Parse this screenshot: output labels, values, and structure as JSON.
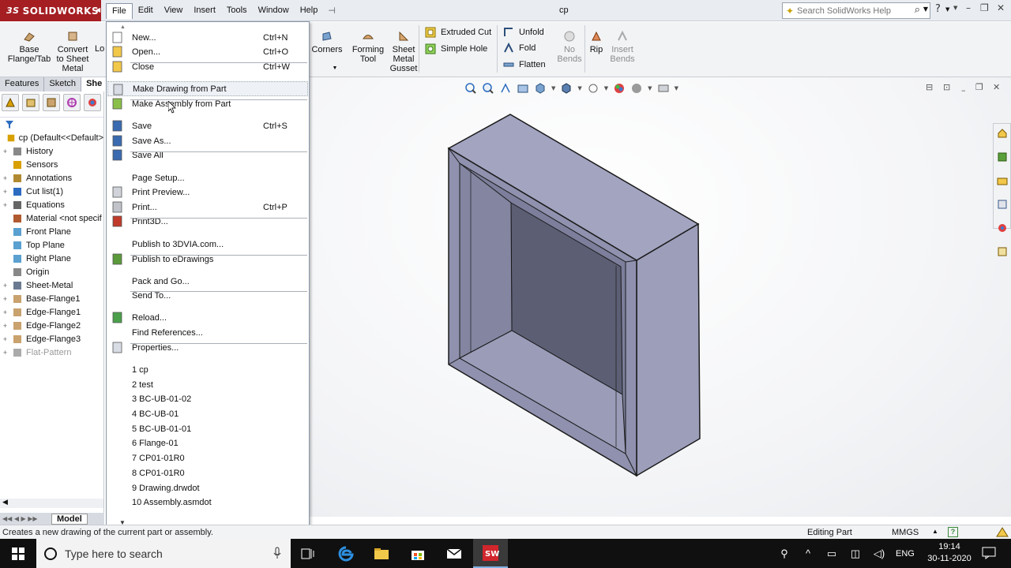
{
  "app": {
    "logo_text": "SOLIDWORKS",
    "logo_prefix": "3S",
    "document_title": "cp"
  },
  "menubar": [
    "File",
    "Edit",
    "View",
    "Insert",
    "Tools",
    "Window",
    "Help"
  ],
  "search": {
    "placeholder": "Search SolidWorks Help"
  },
  "commands": {
    "base_flange": "Base\nFlange/Tab",
    "convert": "Convert\nto Sheet\nMetal",
    "lofted_partial": "Lo",
    "corners": "Corners",
    "forming_tool": "Forming\nTool",
    "sheet_metal_gusset": "Sheet\nMetal\nGusset",
    "extruded_cut": "Extruded Cut",
    "simple_hole": "Simple Hole",
    "unfold": "Unfold",
    "fold": "Fold",
    "flatten": "Flatten",
    "no_bends": "No\nBends",
    "rip": "Rip",
    "insert_bends": "Insert\nBends"
  },
  "tabs": [
    "Features",
    "Sketch",
    "She"
  ],
  "tree": [
    {
      "label": "cp  (Default<<Default>",
      "icon": "part-icon",
      "expander": ""
    },
    {
      "label": "History",
      "icon": "history-icon",
      "expander": "+"
    },
    {
      "label": "Sensors",
      "icon": "sensors-icon",
      "expander": ""
    },
    {
      "label": "Annotations",
      "icon": "annotations-icon",
      "expander": "+"
    },
    {
      "label": "Cut list(1)",
      "icon": "cutlist-icon",
      "expander": "+"
    },
    {
      "label": "Equations",
      "icon": "equations-icon",
      "expander": "+"
    },
    {
      "label": "Material <not specif",
      "icon": "material-icon",
      "expander": ""
    },
    {
      "label": "Front Plane",
      "icon": "plane-icon",
      "expander": ""
    },
    {
      "label": "Top Plane",
      "icon": "plane-icon",
      "expander": ""
    },
    {
      "label": "Right Plane",
      "icon": "plane-icon",
      "expander": ""
    },
    {
      "label": "Origin",
      "icon": "origin-icon",
      "expander": ""
    },
    {
      "label": "Sheet-Metal",
      "icon": "sheetmetal-icon",
      "expander": "+"
    },
    {
      "label": "Base-Flange1",
      "icon": "baseflange-icon",
      "expander": "+"
    },
    {
      "label": "Edge-Flange1",
      "icon": "edgeflange-icon",
      "expander": "+"
    },
    {
      "label": "Edge-Flange2",
      "icon": "edgeflange-icon",
      "expander": "+"
    },
    {
      "label": "Edge-Flange3",
      "icon": "edgeflange-icon",
      "expander": "+"
    },
    {
      "label": "Flat-Pattern",
      "icon": "flatpattern-icon",
      "expander": "+",
      "greyed": true
    }
  ],
  "bottom_tab": "Model",
  "file_menu": [
    {
      "label": "New...",
      "shortcut": "Ctrl+N",
      "icon": "new-icon"
    },
    {
      "label": "Open...",
      "shortcut": "Ctrl+O",
      "icon": "open-icon"
    },
    {
      "label": "Close",
      "shortcut": "Ctrl+W",
      "icon": "close-doc-icon"
    },
    {
      "label": "Make Drawing from Part",
      "shortcut": "",
      "icon": "make-drawing-icon",
      "hover": true
    },
    {
      "label": "Make Assembly from Part",
      "shortcut": "",
      "icon": "make-assembly-icon"
    },
    {
      "label": "Save",
      "shortcut": "Ctrl+S",
      "icon": "save-icon"
    },
    {
      "label": "Save As...",
      "shortcut": "",
      "icon": "save-as-icon"
    },
    {
      "label": "Save All",
      "shortcut": "",
      "icon": "save-all-icon"
    },
    {
      "label": "Page Setup...",
      "shortcut": "",
      "icon": ""
    },
    {
      "label": "Print Preview...",
      "shortcut": "",
      "icon": "print-preview-icon"
    },
    {
      "label": "Print...",
      "shortcut": "Ctrl+P",
      "icon": "print-icon"
    },
    {
      "label": "Print3D...",
      "shortcut": "",
      "icon": "print3d-icon"
    },
    {
      "label": "Publish to 3DVIA.com...",
      "shortcut": "",
      "icon": ""
    },
    {
      "label": "Publish to eDrawings",
      "shortcut": "",
      "icon": "edrawings-icon"
    },
    {
      "label": "Pack and Go...",
      "shortcut": "",
      "icon": ""
    },
    {
      "label": "Send To...",
      "shortcut": "",
      "icon": ""
    },
    {
      "label": "Reload...",
      "shortcut": "",
      "icon": "reload-icon"
    },
    {
      "label": "Find References...",
      "shortcut": "",
      "icon": ""
    },
    {
      "label": "Properties...",
      "shortcut": "",
      "icon": "properties-icon"
    },
    {
      "label": "1 cp",
      "shortcut": "",
      "icon": ""
    },
    {
      "label": "2 test",
      "shortcut": "",
      "icon": ""
    },
    {
      "label": "3 BC-UB-01-02",
      "shortcut": "",
      "icon": ""
    },
    {
      "label": "4 BC-UB-01",
      "shortcut": "",
      "icon": ""
    },
    {
      "label": "5 BC-UB-01-01",
      "shortcut": "",
      "icon": ""
    },
    {
      "label": "6 Flange-01",
      "shortcut": "",
      "icon": ""
    },
    {
      "label": "7 CP01-01R0",
      "shortcut": "",
      "icon": ""
    },
    {
      "label": "8 CP01-01R0",
      "shortcut": "",
      "icon": ""
    },
    {
      "label": "9 Drawing.drwdot",
      "shortcut": "",
      "icon": ""
    },
    {
      "label": "10 Assembly.asmdot",
      "shortcut": "",
      "icon": ""
    }
  ],
  "statusbar": {
    "message": "Creates a new drawing of the current part or assembly.",
    "mode": "Editing Part",
    "units": "MMGS"
  },
  "taskbar": {
    "search_placeholder": "Type here to search",
    "language": "ENG",
    "time": "19:14",
    "date": "30-11-2020"
  },
  "colors": {
    "logo_red": "#a41e22",
    "model_face": "#9a9cb9",
    "model_edge": "#1a1a1a",
    "taskbar": "#101010"
  }
}
